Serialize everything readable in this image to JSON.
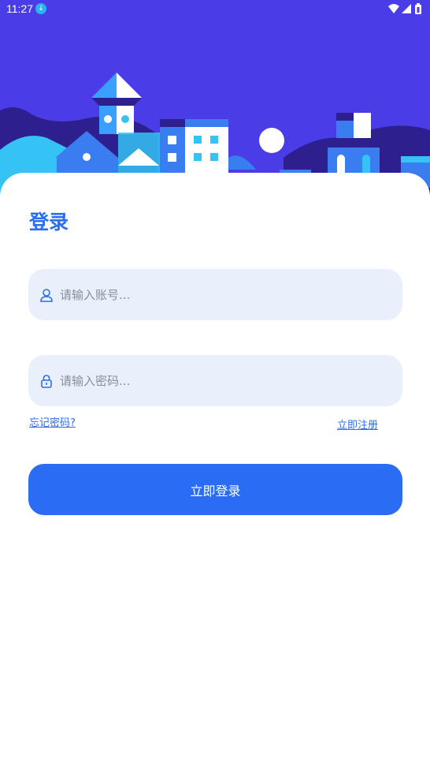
{
  "status_bar": {
    "time": "11:27",
    "icons": [
      "download-icon",
      "wifi-icon",
      "signal-icon",
      "battery-icon"
    ]
  },
  "login": {
    "title": "登录",
    "account_placeholder": "请输入账号...",
    "password_placeholder": "请输入密码...",
    "forgot_label": "忘记密码?",
    "register_label": "立即注册",
    "submit_label": "立即登录"
  },
  "colors": {
    "hero_background": "#4a3ce6",
    "accent": "#2c6df0",
    "button": "#2b6cf5",
    "field_background": "#e9f0fb"
  }
}
